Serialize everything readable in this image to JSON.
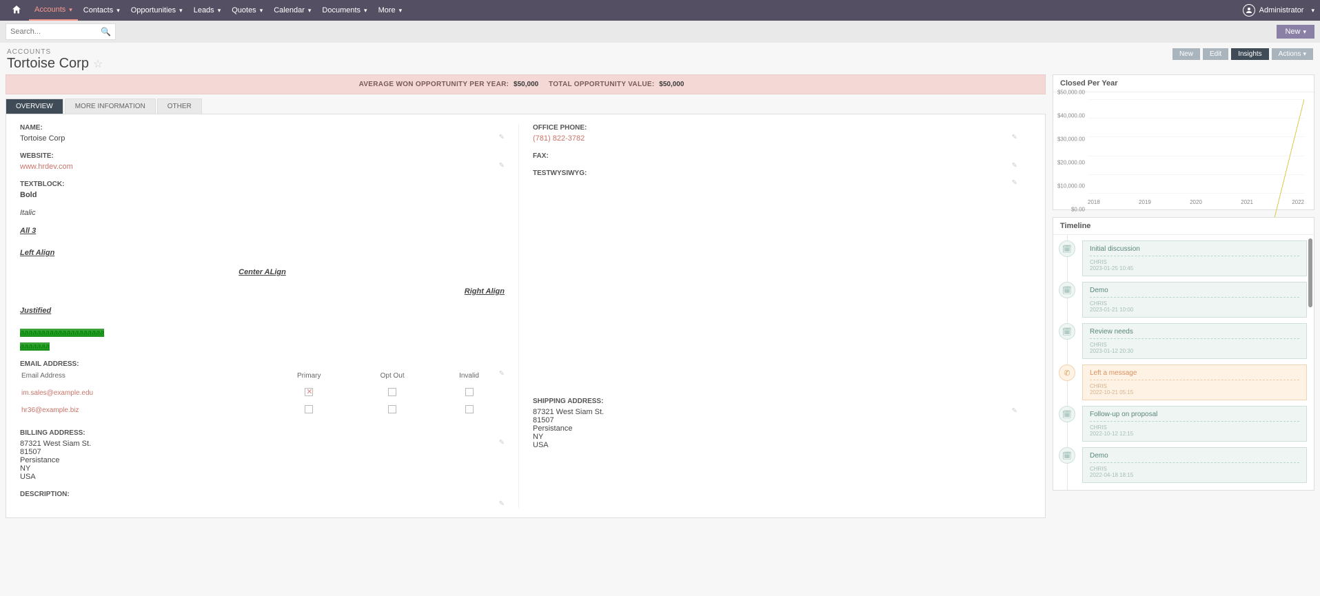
{
  "nav": {
    "items": [
      {
        "label": "Accounts",
        "active": true
      },
      {
        "label": "Contacts"
      },
      {
        "label": "Opportunities"
      },
      {
        "label": "Leads"
      },
      {
        "label": "Quotes"
      },
      {
        "label": "Calendar"
      },
      {
        "label": "Documents"
      },
      {
        "label": "More"
      }
    ],
    "user": "Administrator"
  },
  "search": {
    "placeholder": "Search..."
  },
  "new_button": "New",
  "breadcrumb": "ACCOUNTS",
  "page_title": "Tortoise Corp",
  "header_buttons": {
    "new": "New",
    "edit": "Edit",
    "insights": "Insights",
    "actions": "Actions"
  },
  "kpi": {
    "label1": "AVERAGE WON OPPORTUNITY PER YEAR:",
    "val1": "$50,000",
    "label2": "TOTAL OPPORTUNITY VALUE:",
    "val2": "$50,000"
  },
  "tabs": [
    {
      "label": "OVERVIEW",
      "active": true
    },
    {
      "label": "MORE INFORMATION"
    },
    {
      "label": "OTHER"
    }
  ],
  "fields": {
    "name_label": "NAME:",
    "name_value": "Tortoise Corp",
    "website_label": "WEBSITE:",
    "website_value": "www.hrdev.com",
    "textblock_label": "TEXTBLOCK:",
    "office_phone_label": "OFFICE PHONE:",
    "office_phone_value": "(781) 822-3782",
    "fax_label": "FAX:",
    "testw_label": "TESTWYSIWYG:",
    "email_label": "EMAIL ADDRESS:",
    "billing_label": "BILLING ADDRESS:",
    "shipping_label": "SHIPPING ADDRESS:",
    "description_label": "DESCRIPTION:"
  },
  "textblock": {
    "bold": "Bold",
    "italic": "Italic",
    "all3": "All 3",
    "left": "Left Align",
    "center": "Center ALign",
    "right": "Right Align",
    "justified": "Justified",
    "hl1": "aaaaaaaaaaaaaaaaaaaa",
    "hl2": "aaaaaaa"
  },
  "email_table": {
    "cols": [
      "Email Address",
      "Primary",
      "Opt Out",
      "Invalid"
    ],
    "rows": [
      {
        "email": "im.sales@example.edu",
        "primary": true,
        "optout": false,
        "invalid": false
      },
      {
        "email": "hr36@example.biz",
        "primary": false,
        "optout": false,
        "invalid": false
      }
    ]
  },
  "billing": {
    "l1": "87321 West Siam St.",
    "l2": "81507",
    "l3": "Persistance",
    "l4": "NY",
    "l5": "USA"
  },
  "shipping": {
    "l1": "87321 West Siam St.",
    "l2": "81507",
    "l3": "Persistance",
    "l4": "NY",
    "l5": "USA"
  },
  "chart_widget_title": "Closed Per Year",
  "timeline_title": "Timeline",
  "timeline": [
    {
      "type": "meeting",
      "title": "Initial discussion",
      "user": "CHRIS",
      "time": "2023-01-25 10:45"
    },
    {
      "type": "meeting",
      "title": "Demo",
      "user": "CHRIS",
      "time": "2023-01-21 10:00"
    },
    {
      "type": "meeting",
      "title": "Review needs",
      "user": "CHRIS",
      "time": "2023-01-12 20:30"
    },
    {
      "type": "call",
      "title": "Left a message",
      "user": "CHRIS",
      "time": "2022-10-21 05:15"
    },
    {
      "type": "meeting",
      "title": "Follow-up on proposal",
      "user": "CHRIS",
      "time": "2022-10-12 12:15"
    },
    {
      "type": "meeting",
      "title": "Demo",
      "user": "CHRIS",
      "time": "2022-04-18 18:15"
    }
  ],
  "chart_data": {
    "type": "line",
    "title": "Closed Per Year",
    "xlabel": "",
    "ylabel": "",
    "categories": [
      "2018",
      "2019",
      "2020",
      "2021",
      "2022"
    ],
    "values": [
      0,
      0,
      0,
      0,
      50000
    ],
    "ylim": [
      0,
      50000
    ],
    "yticks": [
      "$0.00",
      "$10,000.00",
      "$20,000.00",
      "$30,000.00",
      "$40,000.00",
      "$50,000.00"
    ]
  }
}
